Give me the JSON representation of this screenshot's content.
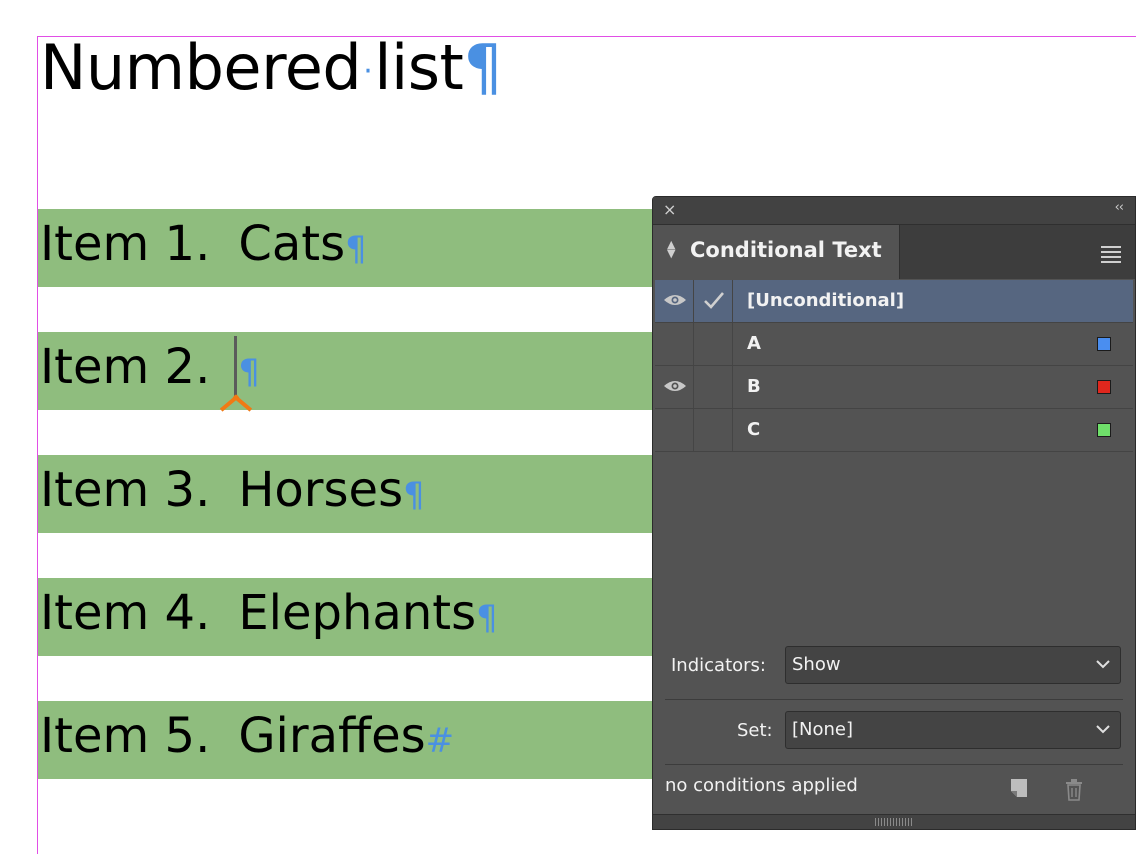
{
  "document": {
    "heading": {
      "text_before": "Numbered",
      "text_after": "list",
      "pilcrow": "¶",
      "space_dot": "·"
    },
    "items": [
      {
        "number": "Item 1.",
        "text": "Cats",
        "mark": "¶"
      },
      {
        "number": "Item 2.",
        "text": "",
        "mark": "¶"
      },
      {
        "number": "Item 3.",
        "text": "Horses",
        "mark": "¶"
      },
      {
        "number": "Item 4.",
        "text": "Elephants",
        "mark": "¶"
      },
      {
        "number": "Item 5.",
        "text": "Giraffes",
        "mark": "#"
      }
    ],
    "colors": {
      "band": "#8fbd7e",
      "hidden_char": "#4a90e2",
      "page_edge": "#e14ee6"
    }
  },
  "panel": {
    "close_glyph": "×",
    "collapse_glyph": "‹‹",
    "tab_title": "Conditional Text",
    "conditions": [
      {
        "name": "[Unconditional]",
        "visible": true,
        "checked": true,
        "selected": true,
        "color": ""
      },
      {
        "name": "A",
        "visible": false,
        "checked": false,
        "selected": false,
        "color": "#4a8ef0"
      },
      {
        "name": "B",
        "visible": true,
        "checked": false,
        "selected": false,
        "color": "#e0271d"
      },
      {
        "name": "C",
        "visible": false,
        "checked": false,
        "selected": false,
        "color": "#6fe06a"
      }
    ],
    "indicators_label": "Indicators:",
    "indicators_value": "Show",
    "set_label": "Set:",
    "set_value": "[None]",
    "status": "no conditions applied"
  }
}
